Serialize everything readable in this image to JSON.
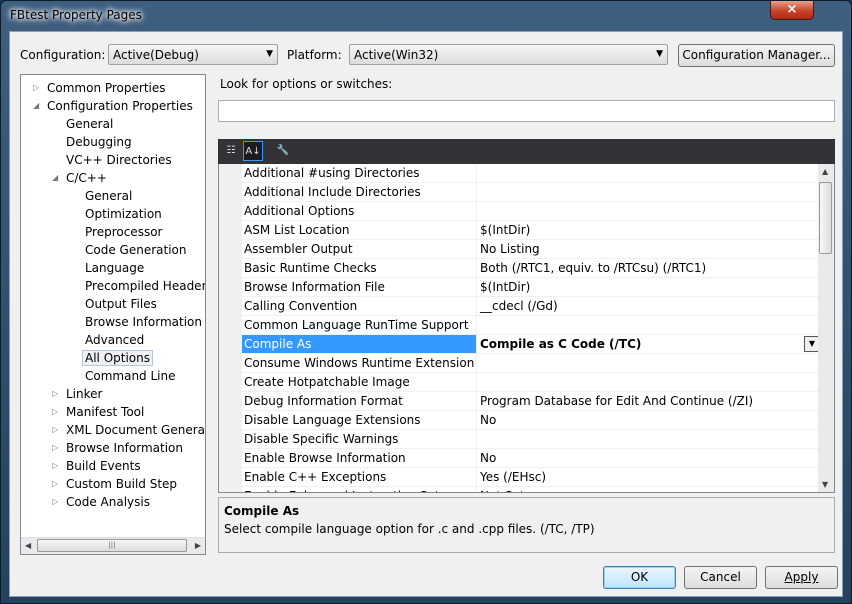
{
  "window": {
    "title": "FBtest Property Pages",
    "close_glyph": "×"
  },
  "header": {
    "configuration_label": "Configuration:",
    "configuration_value": "Active(Debug)",
    "platform_label": "Platform:",
    "platform_value": "Active(Win32)",
    "config_manager_label": "Configuration Manager..."
  },
  "tree": {
    "common_properties": "Common Properties",
    "configuration_properties": "Configuration Properties",
    "general": "General",
    "debugging": "Debugging",
    "vc_directories": "VC++ Directories",
    "cc": "C/C++",
    "cc_children": [
      "General",
      "Optimization",
      "Preprocessor",
      "Code Generation",
      "Language",
      "Precompiled Headers",
      "Output Files",
      "Browse Information",
      "Advanced",
      "All Options",
      "Command Line"
    ],
    "after": [
      "Linker",
      "Manifest Tool",
      "XML Document Generator",
      "Browse Information",
      "Build Events",
      "Custom Build Step",
      "Code Analysis"
    ],
    "selected": "All Options"
  },
  "search": {
    "label": "Look for options or switches:",
    "value": ""
  },
  "toolbar": {
    "categorized_icon": "categorized-icon",
    "alphabetical_icon": "alphabetical-icon",
    "property_pages_icon": "wrench-icon"
  },
  "grid": {
    "rows": [
      {
        "name": "Additional #using Directories",
        "value": ""
      },
      {
        "name": "Additional Include Directories",
        "value": ""
      },
      {
        "name": "Additional Options",
        "value": ""
      },
      {
        "name": "ASM List Location",
        "value": "$(IntDir)"
      },
      {
        "name": "Assembler Output",
        "value": "No Listing"
      },
      {
        "name": "Basic Runtime Checks",
        "value": "Both (/RTC1, equiv. to /RTCsu) (/RTC1)"
      },
      {
        "name": "Browse Information File",
        "value": "$(IntDir)"
      },
      {
        "name": "Calling Convention",
        "value": "__cdecl (/Gd)"
      },
      {
        "name": "Common Language RunTime Support",
        "value": ""
      },
      {
        "name": "Compile As",
        "value": "Compile as C Code (/TC)"
      },
      {
        "name": "Consume Windows Runtime Extension",
        "value": ""
      },
      {
        "name": "Create Hotpatchable Image",
        "value": ""
      },
      {
        "name": "Debug Information Format",
        "value": "Program Database for Edit And Continue (/ZI)"
      },
      {
        "name": "Disable Language Extensions",
        "value": "No"
      },
      {
        "name": "Disable Specific Warnings",
        "value": ""
      },
      {
        "name": "Enable Browse Information",
        "value": "No"
      },
      {
        "name": "Enable C++ Exceptions",
        "value": "Yes (/EHsc)"
      },
      {
        "name": "Enable Enhanced Instruction Set",
        "value": "Not Set"
      }
    ],
    "selected_index": 9
  },
  "description": {
    "title": "Compile As",
    "text": "Select compile language option for .c and .cpp files.     (/TC, /TP)"
  },
  "buttons": {
    "ok": "OK",
    "cancel": "Cancel",
    "apply": "Apply"
  }
}
